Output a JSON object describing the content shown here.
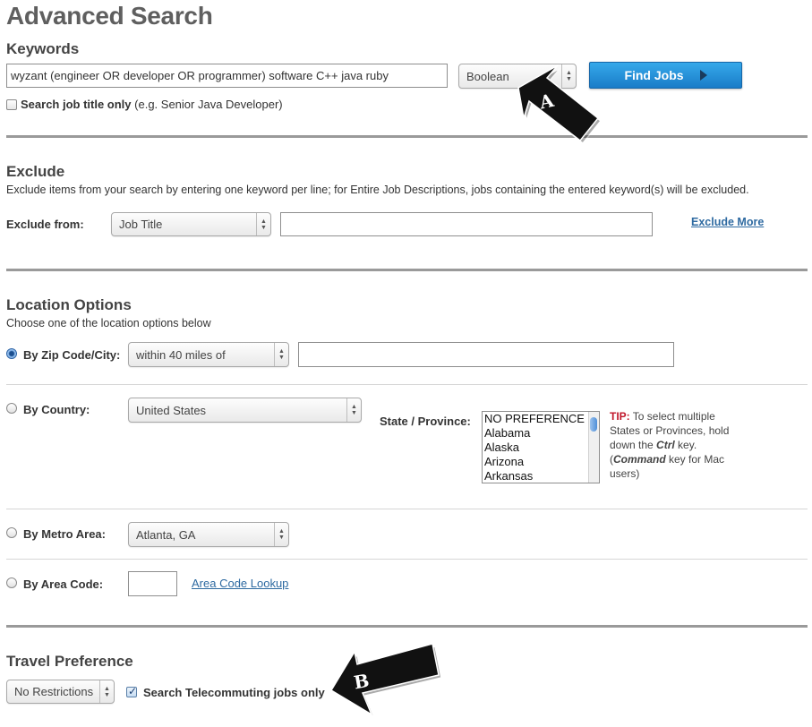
{
  "page_title": "Advanced Search",
  "keywords": {
    "title": "Keywords",
    "query_value": "wyzant (engineer OR developer OR programmer) software C++ java ruby",
    "mode_select": "Boolean",
    "find_button": "Find Jobs",
    "title_only_label": "Search job title only",
    "title_only_hint": "(e.g. Senior Java Developer)",
    "title_only_checked": false
  },
  "exclude": {
    "title": "Exclude",
    "description": "Exclude items from your search by entering one keyword per line; for Entire Job Descriptions, jobs containing the entered keyword(s) will be excluded.",
    "from_label": "Exclude from:",
    "from_select": "Job Title",
    "keyword_value": "",
    "more_link": "Exclude More"
  },
  "location": {
    "title": "Location Options",
    "description": "Choose one of the location options below",
    "zip": {
      "label": "By Zip Code/City:",
      "radius_select": "within 40 miles of",
      "value": "",
      "selected": true
    },
    "country": {
      "label": "By Country:",
      "select": "United States",
      "selected": false
    },
    "state": {
      "label": "State / Province:",
      "options": [
        "NO PREFERENCE",
        "Alabama",
        "Alaska",
        "Arizona",
        "Arkansas"
      ]
    },
    "tip": {
      "label": "TIP:",
      "line1": " To select multiple",
      "line2": "States or Provinces, hold",
      "line3_pre": "down the ",
      "line3_key": "Ctrl",
      "line3_post": " key.",
      "line4_pre": "(",
      "line4_key": "Command",
      "line4_post": " key for Mac",
      "line5": "users)"
    },
    "metro": {
      "label": "By Metro Area:",
      "select": "Atlanta, GA",
      "selected": false
    },
    "area_code": {
      "label": "By Area Code:",
      "value": "",
      "lookup_link": "Area Code Lookup",
      "selected": false
    }
  },
  "travel": {
    "title": "Travel Preference",
    "select": "No Restrictions",
    "telecommute_label": "Search Telecommuting jobs only",
    "telecommute_checked": true
  },
  "annotations": {
    "arrow_a": "A",
    "arrow_b": "B"
  },
  "colors": {
    "find_button": "#1a7cc8",
    "tip_label": "#c0162a",
    "link": "#2e6aa1"
  }
}
